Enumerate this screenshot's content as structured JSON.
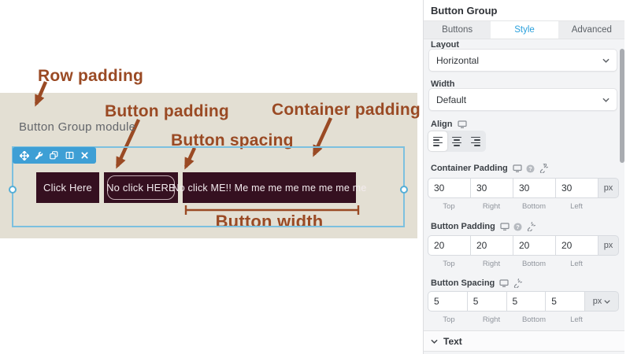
{
  "dim_labels": [
    "Top",
    "Right",
    "Bottom",
    "Left"
  ],
  "canvas": {
    "module_label": "Button Group module",
    "annotations": {
      "row_padding": "Row padding",
      "button_padding": "Button padding",
      "button_spacing": "Button spacing",
      "container_padding": "Container padding",
      "button_width": "Button width"
    },
    "buttons": [
      "Click Here",
      "No click HERE",
      "No click ME!! Me me me me me me me me"
    ]
  },
  "panel": {
    "title": "Button Group",
    "tabs": [
      "Buttons",
      "Style",
      "Advanced"
    ],
    "active_tab": "Style",
    "layout": {
      "label": "Layout",
      "value": "Horizontal"
    },
    "width": {
      "label": "Width",
      "value": "Default"
    },
    "align": {
      "label": "Align"
    },
    "container_padding": {
      "label": "Container Padding",
      "values": [
        "30",
        "30",
        "30",
        "30"
      ],
      "unit": "px"
    },
    "button_padding": {
      "label": "Button Padding",
      "values": [
        "20",
        "20",
        "20",
        "20"
      ],
      "unit": "px"
    },
    "button_spacing": {
      "label": "Button Spacing",
      "values": [
        "5",
        "5",
        "5",
        "5"
      ],
      "unit": "px"
    },
    "text_section": {
      "label": "Text"
    }
  },
  "colors": {
    "accent_blue": "#2aa0dc",
    "toolbar_blue": "#3e9fd5",
    "selection_blue": "#7cc0df",
    "button_maroon": "#351020",
    "annotation_rust": "#9a4a24",
    "canvas_beige": "#e3dfd3"
  }
}
